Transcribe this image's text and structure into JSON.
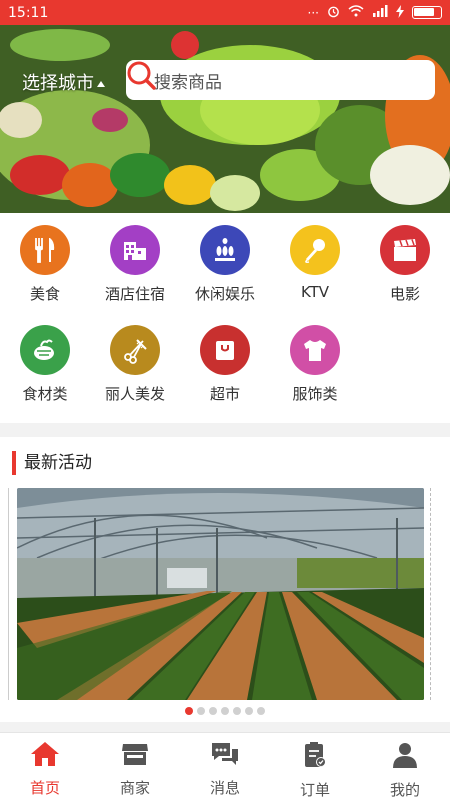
{
  "status": {
    "time": "15:11",
    "dots": "···"
  },
  "header": {
    "city_label": "选择城市",
    "search_placeholder": "搜索商品"
  },
  "categories": [
    {
      "label": "美食",
      "color": "#e8731e",
      "icon": "fork-knife-icon"
    },
    {
      "label": "酒店住宿",
      "color": "#a33fc5",
      "icon": "hotel-icon"
    },
    {
      "label": "休闲娱乐",
      "color": "#3d48b8",
      "icon": "bowling-icon"
    },
    {
      "label": "KTV",
      "color": "#f4c21d",
      "icon": "microphone-icon"
    },
    {
      "label": "电影",
      "color": "#d63238",
      "icon": "clapperboard-icon"
    },
    {
      "label": "食材类",
      "color": "#3aa14a",
      "icon": "vegetable-icon"
    },
    {
      "label": "丽人美发",
      "color": "#b88a1e",
      "icon": "scissors-comb-icon"
    },
    {
      "label": "超市",
      "color": "#c8302f",
      "icon": "shopping-bag-icon"
    },
    {
      "label": "服饰类",
      "color": "#d14fa6",
      "icon": "shirt-icon"
    }
  ],
  "activities": {
    "title": "最新活动",
    "carousel": {
      "count": 7,
      "active_index": 0
    }
  },
  "tabs": [
    {
      "label": "首页",
      "icon": "home-icon",
      "active": true
    },
    {
      "label": "商家",
      "icon": "shop-icon",
      "active": false
    },
    {
      "label": "消息",
      "icon": "message-icon",
      "active": false
    },
    {
      "label": "订单",
      "icon": "order-icon",
      "active": false
    },
    {
      "label": "我的",
      "icon": "user-icon",
      "active": false
    }
  ],
  "colors": {
    "accent": "#e8382f",
    "tab_inactive": "#555555"
  }
}
